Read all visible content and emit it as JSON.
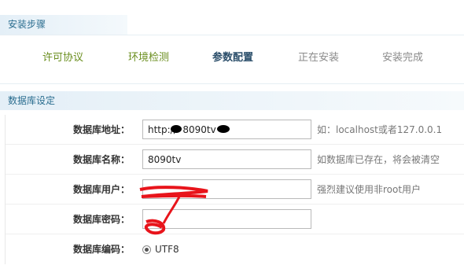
{
  "install_steps": {
    "title": "安装步骤",
    "steps": [
      {
        "label": "许可协议",
        "state": "done"
      },
      {
        "label": "环境检测",
        "state": "done"
      },
      {
        "label": "参数配置",
        "state": "current"
      },
      {
        "label": "正在安装",
        "state": "pending"
      },
      {
        "label": "安装完成",
        "state": "pending"
      }
    ]
  },
  "db_settings": {
    "title": "数据库设定",
    "host": {
      "label": "数据库地址：",
      "value": "http://  8090tv",
      "hint": "如：localhost或者127.0.0.1"
    },
    "name": {
      "label": "数据库名称：",
      "value": "8090tv",
      "hint": "如数据库已存在，将会被清空"
    },
    "user": {
      "label": "数据库用户：",
      "value": "",
      "hint": "强烈建议使用非root用户"
    },
    "password": {
      "label": "数据库密码：",
      "value": ""
    },
    "charset": {
      "label": "数据库编码：",
      "option": "UTF8",
      "selected": true
    }
  },
  "colors": {
    "step_done": "#6a8e1e",
    "step_current": "#2b4e6a",
    "step_pending": "#8a8a8a",
    "header_text": "#2a6d8f",
    "redaction_black": "#000000",
    "redaction_red": "#e8141b"
  }
}
